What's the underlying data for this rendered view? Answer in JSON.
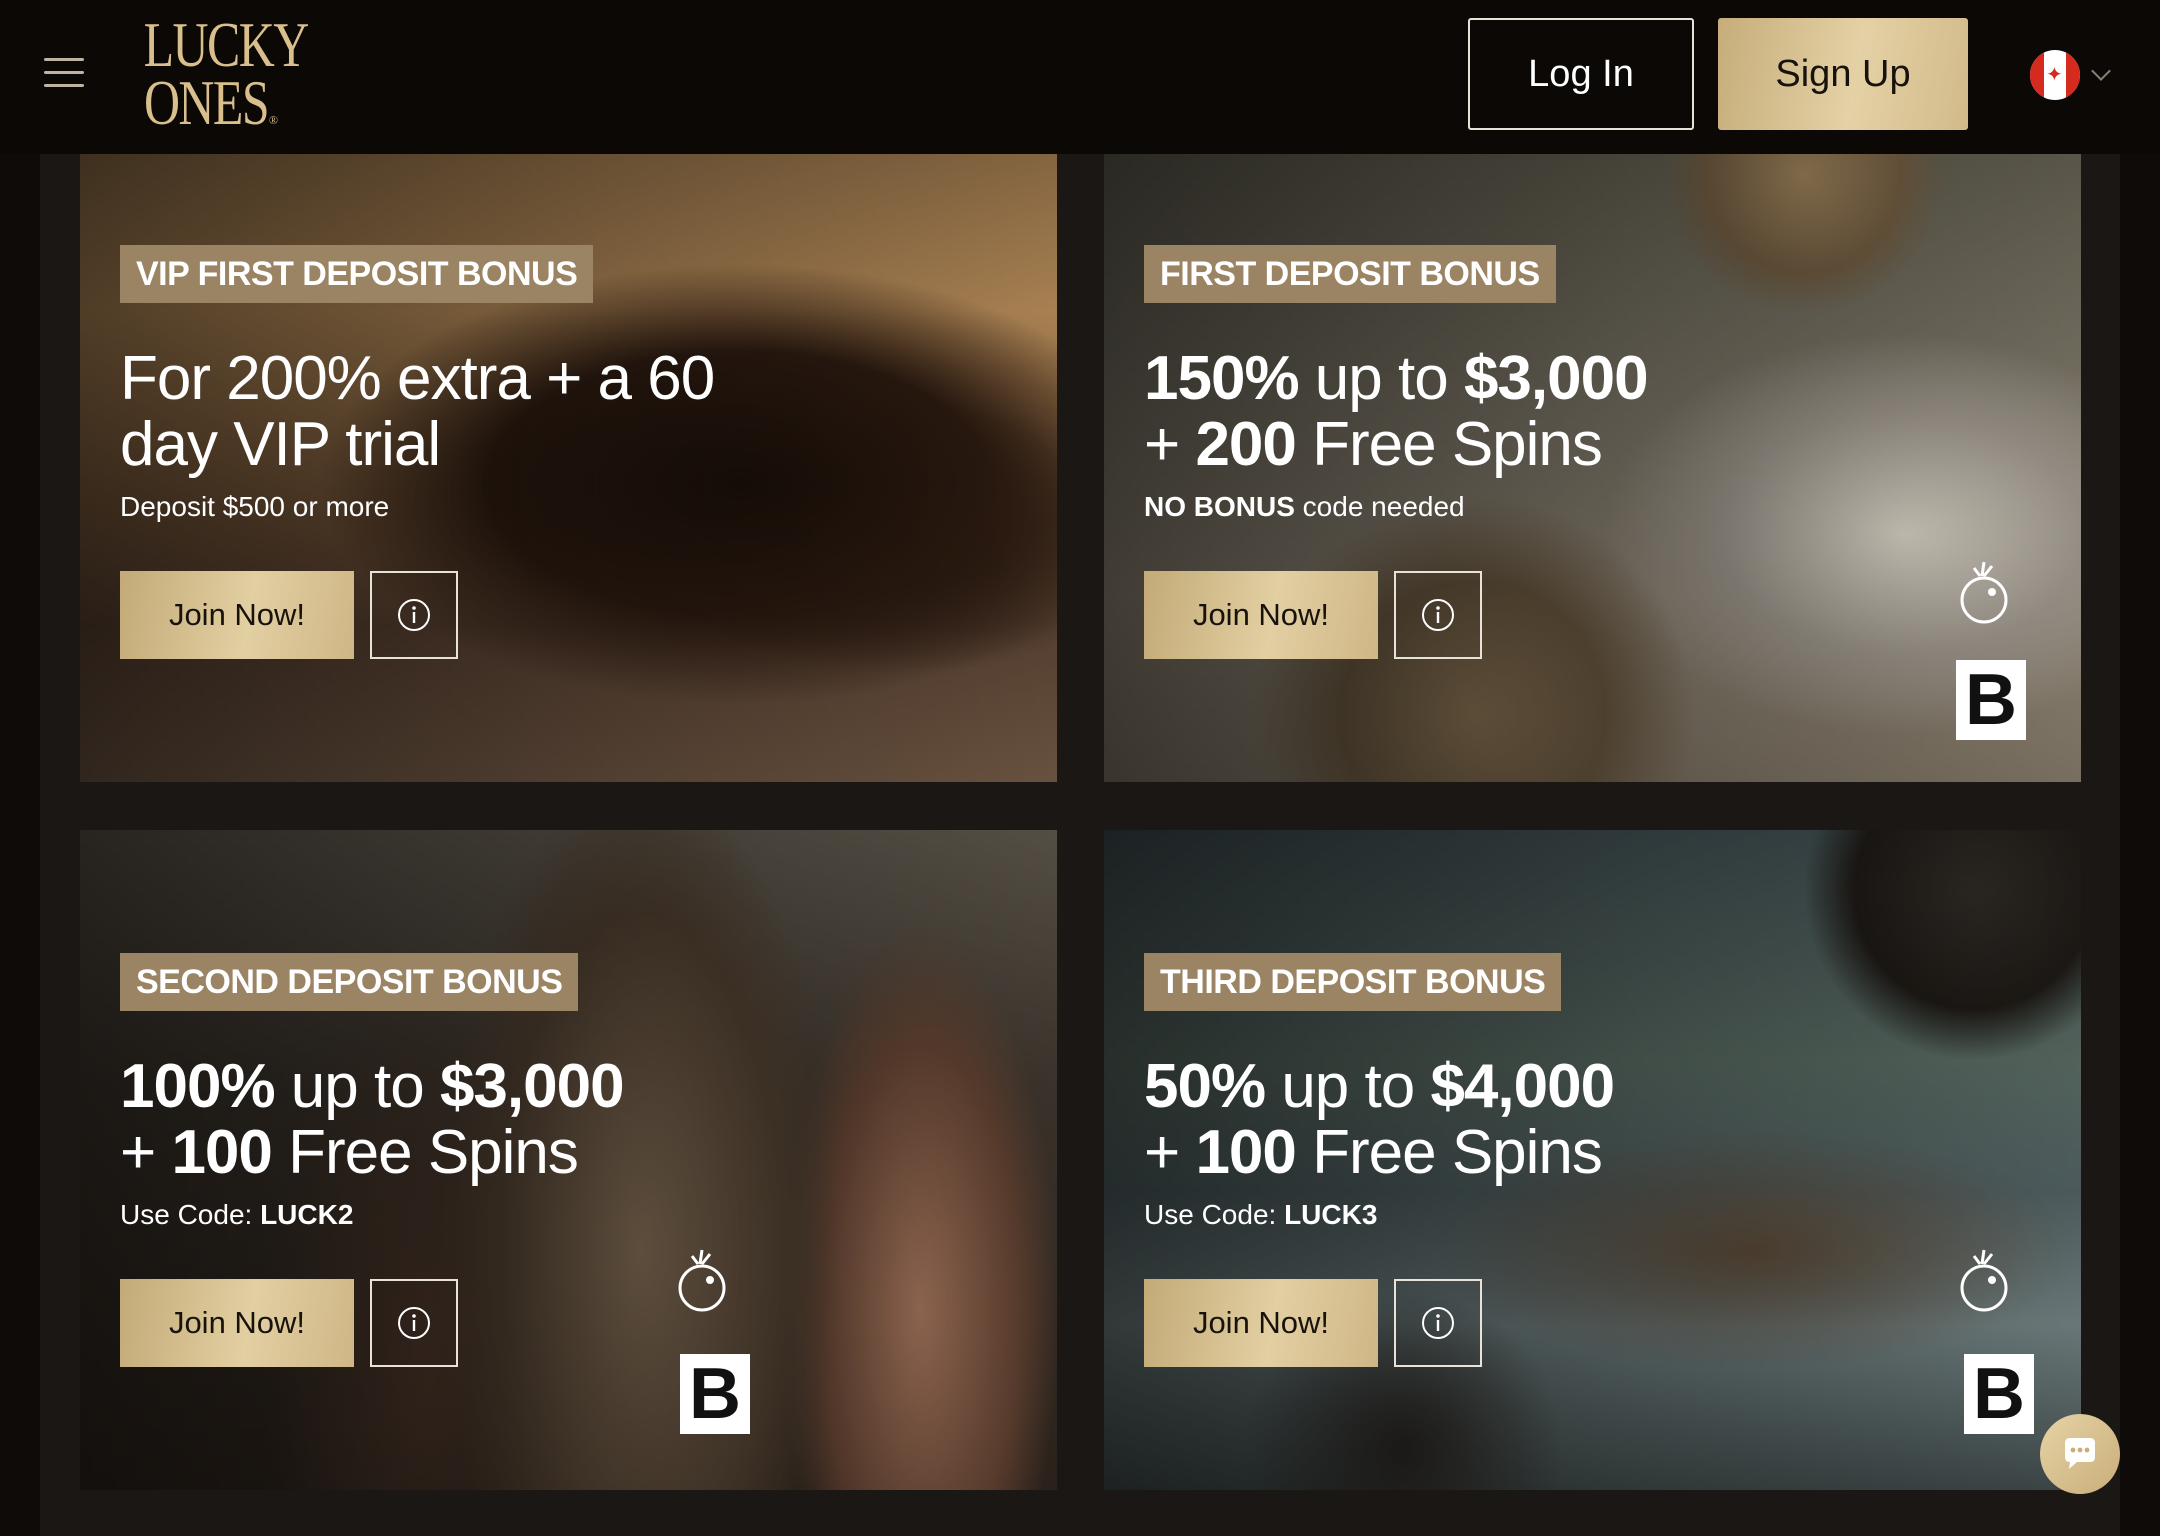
{
  "header": {
    "logo_line1": "LUCKY",
    "logo_line2": "ONES",
    "logo_reg": "®",
    "login_label": "Log In",
    "signup_label": "Sign Up",
    "flag_icon": "canada-flag-icon",
    "menu_icon": "hamburger-menu-icon"
  },
  "colors": {
    "accent_gold": "#d9bf8c",
    "badge_bg": "#9b8463",
    "page_bg": "#1b1714",
    "header_bg": "#0b0806"
  },
  "cards": [
    {
      "badge": "VIP FIRST DEPOSIT BONUS",
      "headline_line1": "For 200% extra + a 60",
      "headline_line2": "day VIP trial",
      "sub_text": "Deposit $500 or more",
      "join_label": "Join Now!"
    },
    {
      "badge": "FIRST DEPOSIT BONUS",
      "headline_pct": "150%",
      "headline_mid": " up to ",
      "headline_amount": "$3,000",
      "headline_line2_prefix": "+ ",
      "headline_spins": "200",
      "headline_line2_suffix": " Free Spins",
      "sub_bold": "NO BONUS",
      "sub_text": " code needed",
      "join_label": "Join Now!"
    },
    {
      "badge": "SECOND DEPOSIT BONUS",
      "headline_pct": "100%",
      "headline_mid": " up to ",
      "headline_amount": "$3,000",
      "headline_line2_prefix": "+ ",
      "headline_spins": "100",
      "headline_line2_suffix": " Free Spins",
      "sub_text": "Use Code: ",
      "sub_bold": "LUCK2",
      "join_label": "Join Now!"
    },
    {
      "badge": "THIRD DEPOSIT BONUS",
      "headline_pct": "50%",
      "headline_mid": " up to ",
      "headline_amount": "$4,000",
      "headline_line2_prefix": "+ ",
      "headline_spins": "100",
      "headline_line2_suffix": " Free Spins",
      "sub_text": "Use Code: ",
      "sub_bold": "LUCK3",
      "join_label": "Join Now!"
    }
  ],
  "marks": {
    "b_letter": "B"
  },
  "chat": {
    "icon": "chat-bubble-icon"
  }
}
